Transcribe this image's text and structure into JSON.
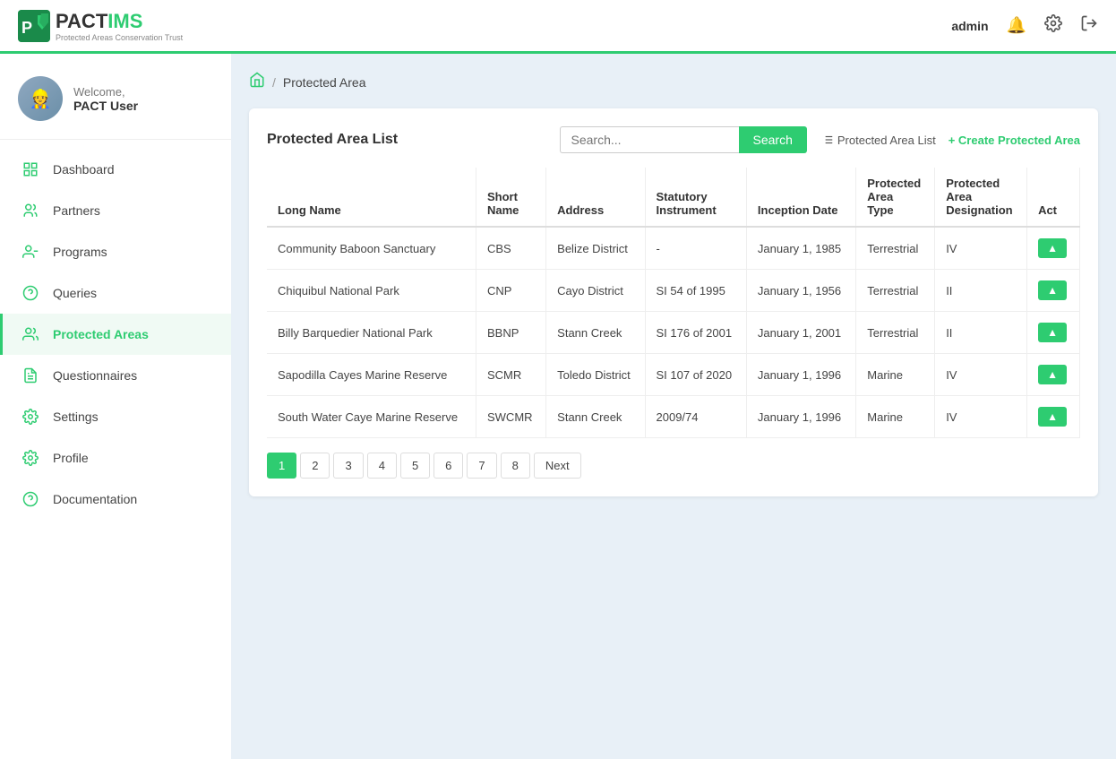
{
  "topnav": {
    "logo_pact": "PACT",
    "logo_ims": "IMS",
    "logo_subtitle": "Protected Areas Conservation Trust",
    "admin_label": "admin",
    "notifications_icon": "🔔",
    "settings_icon": "⚙",
    "logout_icon": "→"
  },
  "sidebar": {
    "welcome_text": "Welcome,",
    "username": "PACT User",
    "nav_items": [
      {
        "id": "dashboard",
        "label": "Dashboard",
        "icon": "📊",
        "active": false
      },
      {
        "id": "partners",
        "label": "Partners",
        "icon": "🤝",
        "active": false
      },
      {
        "id": "programs",
        "label": "Programs",
        "icon": "📋",
        "active": false
      },
      {
        "id": "queries",
        "label": "Queries",
        "icon": "❓",
        "active": false
      },
      {
        "id": "protected-areas",
        "label": "Protected Areas",
        "icon": "👥",
        "active": true
      },
      {
        "id": "questionnaires",
        "label": "Questionnaires",
        "icon": "📝",
        "active": false
      },
      {
        "id": "settings",
        "label": "Settings",
        "icon": "⚙",
        "active": false
      },
      {
        "id": "profile",
        "label": "Profile",
        "icon": "⚙",
        "active": false
      },
      {
        "id": "documentation",
        "label": "Documentation",
        "icon": "❓",
        "active": false
      }
    ]
  },
  "breadcrumb": {
    "home_label": "🏠",
    "separator": "/",
    "current": "Protected Area"
  },
  "main": {
    "card_title": "Protected Area List",
    "search_placeholder": "Search...",
    "search_button": "Search",
    "list_link": "Protected Area List",
    "create_link": "+ Create Protected Area",
    "table": {
      "headers": [
        "Long Name",
        "Short Name",
        "Address",
        "Statutory Instrument",
        "Inception Date",
        "Protected Area Type",
        "Protected Area Designation",
        "Act"
      ],
      "rows": [
        {
          "long_name": "Community Baboon Sanctuary",
          "short_name": "CBS",
          "address": "Belize District",
          "statutory_instrument": "-",
          "inception_date": "January 1, 1985",
          "type": "Terrestrial",
          "designation": "IV",
          "action": "▲"
        },
        {
          "long_name": "Chiquibul National Park",
          "short_name": "CNP",
          "address": "Cayo District",
          "statutory_instrument": "SI 54 of 1995",
          "inception_date": "January 1, 1956",
          "type": "Terrestrial",
          "designation": "II",
          "action": "▲"
        },
        {
          "long_name": "Billy Barquedier National Park",
          "short_name": "BBNP",
          "address": "Stann Creek",
          "statutory_instrument": "SI 176 of 2001",
          "inception_date": "January 1, 2001",
          "type": "Terrestrial",
          "designation": "II",
          "action": "▲"
        },
        {
          "long_name": "Sapodilla Cayes Marine Reserve",
          "short_name": "SCMR",
          "address": "Toledo District",
          "statutory_instrument": "SI 107 of 2020",
          "inception_date": "January 1, 1996",
          "type": "Marine",
          "designation": "IV",
          "action": "▲"
        },
        {
          "long_name": "South Water Caye Marine Reserve",
          "short_name": "SWCMR",
          "address": "Stann Creek",
          "statutory_instrument": "2009/74",
          "inception_date": "January 1, 1996",
          "type": "Marine",
          "designation": "IV",
          "action": "▲"
        }
      ]
    },
    "pagination": {
      "pages": [
        "1",
        "2",
        "3",
        "4",
        "5",
        "6",
        "7",
        "8"
      ],
      "next_label": "Next",
      "active_page": "1"
    }
  }
}
